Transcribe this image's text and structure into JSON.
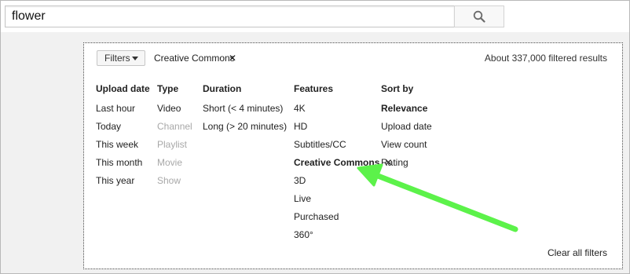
{
  "search": {
    "query": "flower",
    "button_icon": "search-icon"
  },
  "filter_bar": {
    "filters_label": "Filters",
    "active_filter": "Creative Commons",
    "result_count": "About 337,000 filtered results"
  },
  "columns": [
    {
      "key": "upload_date",
      "title": "Upload date",
      "items": [
        {
          "label": "Last hour"
        },
        {
          "label": "Today"
        },
        {
          "label": "This week"
        },
        {
          "label": "This month"
        },
        {
          "label": "This year"
        }
      ]
    },
    {
      "key": "type",
      "title": "Type",
      "items": [
        {
          "label": "Video"
        },
        {
          "label": "Channel"
        },
        {
          "label": "Playlist"
        },
        {
          "label": "Movie"
        },
        {
          "label": "Show"
        }
      ]
    },
    {
      "key": "duration",
      "title": "Duration",
      "items": [
        {
          "label": "Short (< 4 minutes)"
        },
        {
          "label": "Long (> 20 minutes)"
        }
      ]
    },
    {
      "key": "features",
      "title": "Features",
      "items": [
        {
          "label": "4K"
        },
        {
          "label": "HD"
        },
        {
          "label": "Subtitles/CC"
        },
        {
          "label": "Creative Commons"
        },
        {
          "label": "3D"
        },
        {
          "label": "Live"
        },
        {
          "label": "Purchased"
        },
        {
          "label": "360°"
        }
      ]
    },
    {
      "key": "sort_by",
      "title": "Sort by",
      "items": [
        {
          "label": "Relevance"
        },
        {
          "label": "Upload date"
        },
        {
          "label": "View count"
        },
        {
          "label": "Rating"
        }
      ]
    }
  ],
  "clear_all_label": "Clear all filters",
  "colors": {
    "annotation_arrow": "#5cf24a",
    "panel_border": "#444444",
    "disabled_text": "#a8a8a8"
  }
}
